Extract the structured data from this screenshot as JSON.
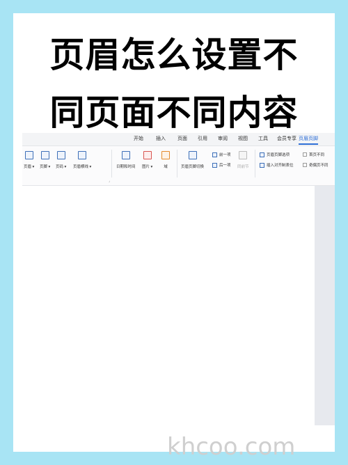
{
  "headline": {
    "line1": "页眉怎么设置不",
    "line2": "同页面不同内容"
  },
  "tabs": [
    {
      "label": "开始"
    },
    {
      "label": "插入"
    },
    {
      "label": "页面"
    },
    {
      "label": "引用"
    },
    {
      "label": "审阅"
    },
    {
      "label": "视图"
    },
    {
      "label": "工具"
    },
    {
      "label": "会员专享"
    },
    {
      "label": "页眉页脚",
      "active": true
    }
  ],
  "ribbon": {
    "header": "页眉",
    "footer": "页脚",
    "page_number": "页码",
    "header_line": "页眉横线",
    "date_time": "日期和时间",
    "picture": "图片",
    "field": "域",
    "switch": "页眉页脚切换",
    "prev": "前一项",
    "next": "后一项",
    "same_as_previous": "同前节",
    "options": "页眉页脚选项",
    "insert_align_tab": "插入对齐制表位",
    "different_first_page": "首页不同",
    "different_odd_even": "奇偶页不同"
  },
  "watermark": "khcoo.com",
  "colors": {
    "background": "#a8e4f4",
    "accent": "#2f6fd6"
  }
}
